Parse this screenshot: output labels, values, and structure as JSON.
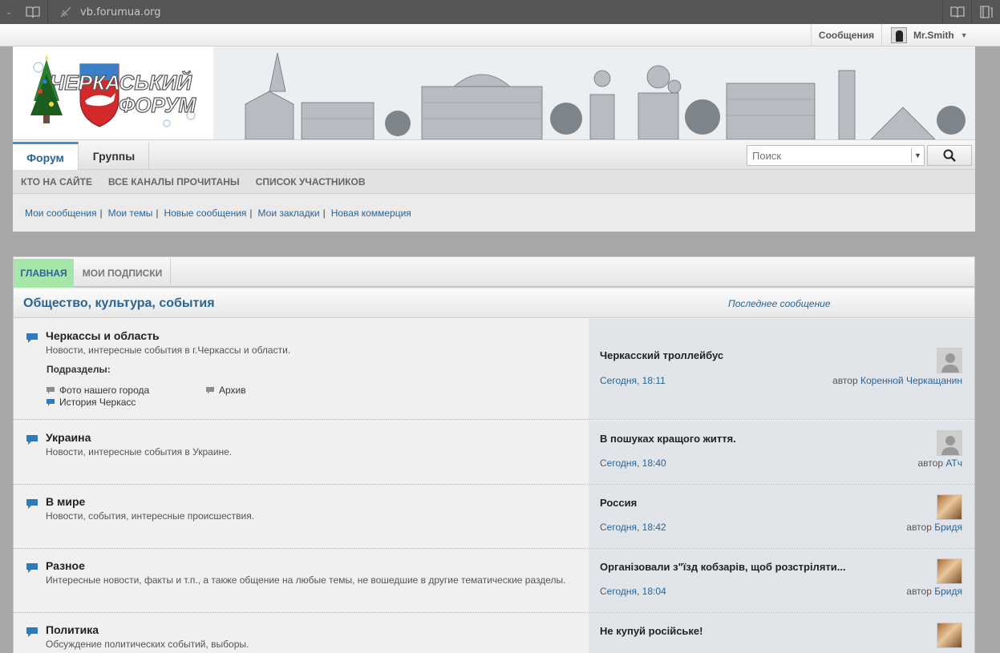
{
  "browser": {
    "url": "vb.forumua.org"
  },
  "topbar": {
    "messages": "Сообщения",
    "username": "Mr.Smith"
  },
  "logo": {
    "line1": "ЧЕРКАСЬКИЙ",
    "line2": "ФОРУМ"
  },
  "nav": {
    "tabs": [
      "Форум",
      "Группы"
    ],
    "search_placeholder": "Поиск",
    "subnav": [
      "КТО НА САЙТЕ",
      "ВСЕ КАНАЛЫ ПРОЧИТАНЫ",
      "СПИСОК УЧАСТНИКОВ"
    ],
    "quicklinks": [
      "Мои сообщения",
      "Мои темы",
      "Новые сообщения",
      "Мои закладки",
      "Новая коммерция"
    ]
  },
  "main": {
    "tabs": [
      "ГЛАВНАЯ",
      "МОИ ПОДПИСКИ"
    ],
    "category": "Общество, культура, события",
    "last_post_label": "Последнее сообщение",
    "forums": [
      {
        "title": "Черкассы и область",
        "desc": "Новости, интересные события в г.Черкассы и области.",
        "subforums_label": "Подразделы:",
        "subforums": [
          "Фото нашего города",
          "Архив",
          "История Черкасс"
        ],
        "last_title": "Черкасский троллейбус",
        "last_date": "Сегодня, 18:11",
        "last_author_prefix": "автор",
        "last_author": "Коренной Черкащанин"
      },
      {
        "title": "Украина",
        "desc": "Новости, интересные события в Украине.",
        "last_title": "В пошуках кращого життя.",
        "last_date": "Сегодня, 18:40",
        "last_author_prefix": "автор",
        "last_author": "АТч"
      },
      {
        "title": "В мире",
        "desc": "Новости, события, интересные происшествия.",
        "last_title": "Россия",
        "last_date": "Сегодня, 18:42",
        "last_author_prefix": "автор",
        "last_author": "Бридя"
      },
      {
        "title": "Разное",
        "desc": "Интересные новости, факты и т.п., а также общение на любые темы, не вошедшие в другие тематические разделы.",
        "last_title": "Організовали з\"їзд кобзарів, щоб розстріляти...",
        "last_date": "Сегодня, 18:04",
        "last_author_prefix": "автор",
        "last_author": "Бридя"
      },
      {
        "title": "Политика",
        "desc": "Обсуждение политических событий, выборы.",
        "last_title": "Не купуй російське!"
      }
    ]
  },
  "colors": {
    "link": "#2a6496",
    "active_tab": "#a6e6a8",
    "lastpost_bg": "#e1e5e9"
  }
}
